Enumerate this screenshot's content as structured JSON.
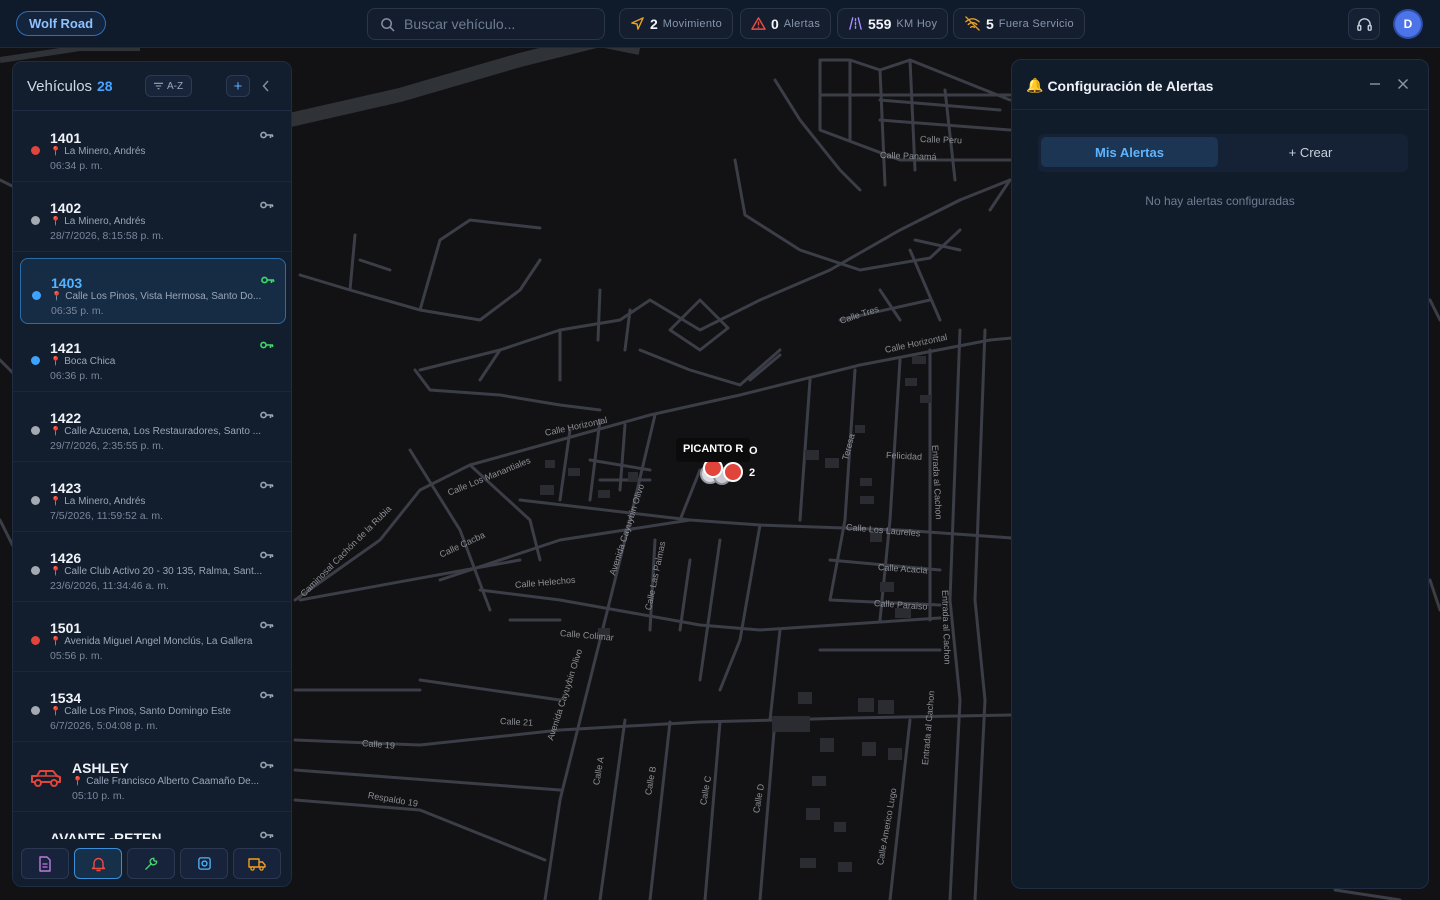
{
  "topbar": {
    "brand": "Wolf Road",
    "search_placeholder": "Buscar vehículo...",
    "stats": [
      {
        "value": "2",
        "label": "Movimiento",
        "icon": "navigation-arrow-icon"
      },
      {
        "value": "0",
        "label": "Alertas",
        "icon": "warning-triangle-icon"
      },
      {
        "value": "559",
        "label": "KM Hoy",
        "icon": "road-icon"
      },
      {
        "value": "5",
        "label": "Fuera Servicio",
        "icon": "no-signal-icon"
      }
    ],
    "avatar_initial": "D",
    "support_icon": "headset-icon"
  },
  "vehicles": {
    "title": "Vehículos",
    "count": "28",
    "sort_label": "A-Z",
    "add_label": "+",
    "items": [
      {
        "name": "1401",
        "address": "La Minero, Andrés",
        "time": "06:34 p. m.",
        "status": "red",
        "key": "gray"
      },
      {
        "name": "1402",
        "address": "La Minero, Andrés",
        "time": "28/7/2026, 8:15:58 p. m.",
        "status": "gray",
        "key": "gray"
      },
      {
        "name": "1403",
        "address": "Calle Los Pinos, Vista Hermosa, Santo Do...",
        "time": "06:35 p. m.",
        "status": "blue",
        "key": "green"
      },
      {
        "name": "1421",
        "address": "Boca Chica",
        "time": "06:36 p. m.",
        "status": "blue",
        "key": "green"
      },
      {
        "name": "1422",
        "address": "Calle Azucena, Los Restauradores, Santo ...",
        "time": "29/7/2026, 2:35:55 p. m.",
        "status": "gray",
        "key": "gray"
      },
      {
        "name": "1423",
        "address": "La Minero, Andrés",
        "time": "7/5/2026, 11:59:52 a. m.",
        "status": "gray",
        "key": "gray"
      },
      {
        "name": "1426",
        "address": "Calle Club Activo 20 - 30 135, Ralma, Sant...",
        "time": "23/6/2026, 11:34:46 a. m.",
        "status": "gray",
        "key": "gray"
      },
      {
        "name": "1501",
        "address": "Avenida Miguel Ángel Monclús, La Gallera",
        "time": "05:56 p. m.",
        "status": "red",
        "key": "gray"
      },
      {
        "name": "1534",
        "address": "Calle Los Pinos, Santo Domingo Este",
        "time": "6/7/2026, 5:04:08 p. m.",
        "status": "gray",
        "key": "gray"
      },
      {
        "name": "ASHLEY",
        "address": "Calle Francisco Alberto Caamaño De...",
        "time": "05:10 p. m.",
        "status": "car",
        "key": "gray"
      },
      {
        "name": "AVANTE -RETEN",
        "address": "",
        "time": "",
        "status": "none",
        "key": "gray"
      }
    ],
    "toolbar": [
      "document-icon",
      "bell-icon",
      "wrench-icon",
      "camera-icon",
      "truck-icon"
    ]
  },
  "alerts": {
    "title": "Configuración de Alertas",
    "tab_active": "Mis Alertas",
    "tab_create": "+ Crear",
    "empty": "No hay alertas configuradas"
  },
  "map": {
    "marker_label": "PICANTO R",
    "marker_label_2": "O 2",
    "streets": [
      "Calle Horizontal",
      "Calle Los Manantiales",
      "Calle Cacba",
      "Calle Helechos",
      "Calle Colimar",
      "Avenida Cayuybin Olivo",
      "Calle Las Palmas",
      "Calle Los Laureles",
      "Calle Acacia",
      "Calle Paraiso",
      "Felicidad",
      "Entrada al Cachon",
      "Calle 21",
      "Calle 19",
      "Respaldo 19",
      "Calle A",
      "Calle B",
      "Calle C",
      "Calle D",
      "Calle Americo Lugo",
      "Caminosal Cachón de la Rubia",
      "Calle Peru",
      "Calle Panamá",
      "Teresa",
      "Calle Tres"
    ],
    "colors": {
      "background": "#121214",
      "road": "#3b3d47",
      "block": "#2a2c31",
      "water": "#2f3338"
    }
  }
}
